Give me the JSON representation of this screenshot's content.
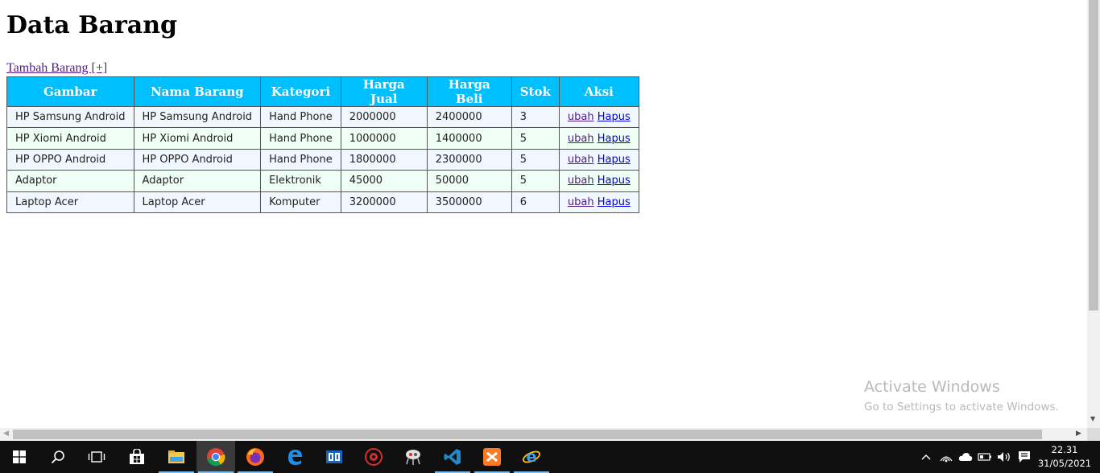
{
  "page": {
    "title": "Data Barang",
    "add_link": "Tambah Barang [+]"
  },
  "table": {
    "headers": [
      "Gambar",
      "Nama Barang",
      "Kategori",
      "Harga Jual",
      "Harga Beli",
      "Stok",
      "Aksi"
    ],
    "rows": [
      {
        "gambar": "HP Samsung Android",
        "nama": "HP Samsung Android",
        "kategori": "Hand Phone",
        "harga_jual": "2000000",
        "harga_beli": "2400000",
        "stok": "3",
        "ubah": "ubah",
        "hapus": "Hapus"
      },
      {
        "gambar": "HP Xiomi Android",
        "nama": "HP Xiomi Android",
        "kategori": "Hand Phone",
        "harga_jual": "1000000",
        "harga_beli": "1400000",
        "stok": "5",
        "ubah": "ubah",
        "hapus": "Hapus"
      },
      {
        "gambar": "HP OPPO Android",
        "nama": "HP OPPO Android",
        "kategori": "Hand Phone",
        "harga_jual": "1800000",
        "harga_beli": "2300000",
        "stok": "5",
        "ubah": "ubah",
        "hapus": "Hapus"
      },
      {
        "gambar": "Adaptor",
        "nama": "Adaptor",
        "kategori": "Elektronik",
        "harga_jual": "45000",
        "harga_beli": "50000",
        "stok": "5",
        "ubah": "ubah",
        "hapus": "Hapus"
      },
      {
        "gambar": "Laptop Acer",
        "nama": "Laptop Acer",
        "kategori": "Komputer",
        "harga_jual": "3200000",
        "harga_beli": "3500000",
        "stok": "6",
        "ubah": "ubah",
        "hapus": "Hapus"
      }
    ]
  },
  "watermark": {
    "title": "Activate Windows",
    "subtitle": "Go to Settings to activate Windows."
  },
  "taskbar": {
    "icons": [
      "windows-start-icon",
      "search-icon",
      "task-view-icon",
      "store-icon",
      "file-explorer-icon",
      "chrome-icon",
      "firefox-icon",
      "edge-icon",
      "media-app-icon",
      "red-app-icon",
      "robot-app-icon",
      "vscode-icon",
      "xampp-icon",
      "internet-explorer-icon"
    ],
    "clock_time": "22.31",
    "clock_date": "31/05/2021"
  },
  "colors": {
    "header_bg": "#00bfff",
    "row_odd": "#f0f7ff",
    "row_even": "#f0fff5",
    "link_visited": "#551a8b",
    "link": "#0000ee",
    "taskbar": "#101010"
  }
}
